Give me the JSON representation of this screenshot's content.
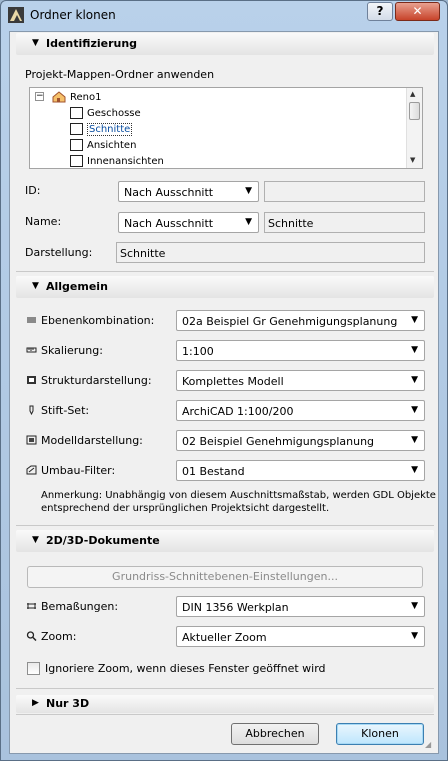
{
  "window": {
    "title": "Ordner klonen",
    "help_label": "?",
    "close_label": "✕"
  },
  "sections": {
    "identifizierung": {
      "label": "Identifizierung"
    },
    "allgemein": {
      "label": "Allgemein"
    },
    "dokumente": {
      "label": "2D/3D-Dokumente"
    },
    "nur3d": {
      "label": "Nur 3D"
    }
  },
  "identification": {
    "folder_label": "Projekt-Mappen-Ordner anwenden",
    "tree": {
      "root": "Reno1",
      "items": [
        "Geschosse",
        "Schnitte",
        "Ansichten",
        "Innenansichten"
      ],
      "selected": "Schnitte"
    },
    "id": {
      "label": "ID:",
      "mode": "Nach Ausschnitt",
      "value": ""
    },
    "name": {
      "label": "Name:",
      "mode": "Nach Ausschnitt",
      "value": "Schnitte"
    },
    "darstellung": {
      "label": "Darstellung:",
      "value": "Schnitte"
    }
  },
  "allgemein_rows": [
    {
      "label": "Ebenenkombination:",
      "value": "02a Beispiel Gr Genehmigungsplanung",
      "icon": "layers-icon"
    },
    {
      "label": "Skalierung:",
      "value": "1:100",
      "icon": "scale-icon"
    },
    {
      "label": "Strukturdarstellung:",
      "value": "Komplettes Modell",
      "icon": "structure-icon"
    },
    {
      "label": "Stift-Set:",
      "value": "ArchiCAD 1:100/200",
      "icon": "pen-icon"
    },
    {
      "label": "Modelldarstellung:",
      "value": "02 Beispiel Genehmigungsplanung",
      "icon": "model-icon"
    },
    {
      "label": "Umbau-Filter:",
      "value": "01 Bestand",
      "icon": "renovation-filter-icon"
    }
  ],
  "note": {
    "line1": "Anmerkung: Unabhängig von diesem Auschnittsmaßstab, werden GDL Objekte",
    "line2": "entsprechend der ursprünglichen Projektsicht dargestellt."
  },
  "docs": {
    "grundriss_button": "Grundriss-Schnittebenen-Einstellungen...",
    "bemassungen": {
      "label": "Bemaßungen:",
      "value": "DIN 1356 Werkplan"
    },
    "zoom": {
      "label": "Zoom:",
      "value": "Aktueller Zoom"
    },
    "ignore_zoom": {
      "label": "Ignoriere Zoom, wenn dieses Fenster geöffnet wird",
      "checked": false
    }
  },
  "footer": {
    "cancel": "Abbrechen",
    "ok": "Klonen"
  }
}
